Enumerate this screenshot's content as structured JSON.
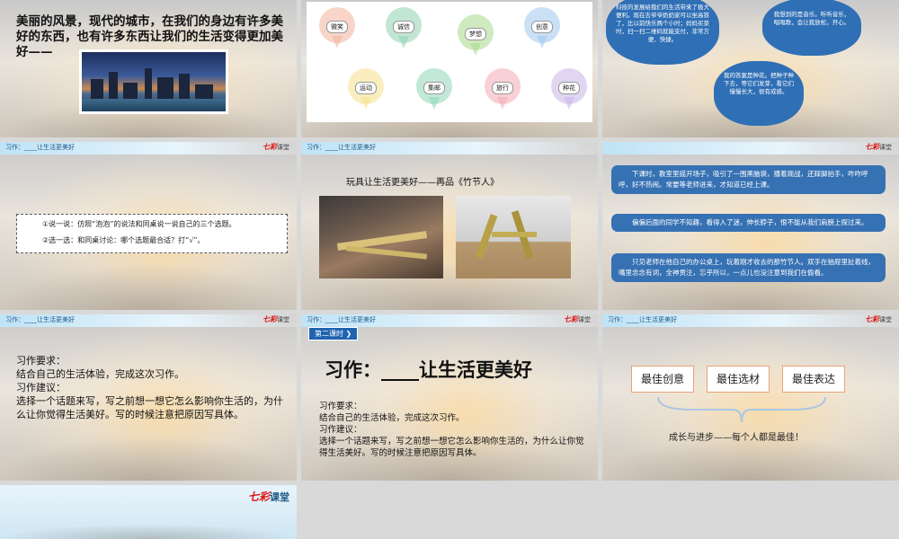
{
  "slides": {
    "s1": {
      "intro": "美丽的风景，现代的城市，在我们的身边有许多美好的东西，也有许多东西让我们的生活变得更加美好——"
    },
    "s2": {
      "bubbles": [
        "微笑",
        "诚信",
        "梦想",
        "创意",
        "运动",
        "集邮",
        "旅行",
        "种花"
      ]
    },
    "s3": {
      "cloud1": "科技的发展给我们的生活带来了极大便利。现在去爷爷奶奶家可以坐高铁了，比以前快乐两个小时；妈妈买菜时，扫一扫二维码就能支付，非常方便、快捷。",
      "cloud2": "我想到的是音乐。听听音乐，唱唱歌，会让我放松，开心。",
      "cloud3": "我的答案是种花。把种子种下去，等它们发芽，看它们慢慢长大，很有成感。"
    },
    "header": {
      "label": "习作：____让生活更美好",
      "logo": "七彩",
      "logo_sub": "课堂"
    },
    "s4": {
      "line1": "①说一说：仿照“泡泡”的说法和同桌说一说自己的三个选题。",
      "line2": "②选一选：和同桌讨论：哪个选题最合适？打“√”。"
    },
    "s5": {
      "title": "玩具让生活更美好——再品《竹节人》"
    },
    "s6": {
      "para1": "下课时，教室里摇开场子，吸引了一围黑脑袋，播着观战，还踩脚拍手，咋咋呼呼，好不热闹。常要等老师进来，才知道已经上课。",
      "para2": "偏偏后面的同学不知趣，看得入了迷，伸长脖子，恨不能从我们肩膀上探过来。",
      "para3": "只见老师在他自己的办公桌上，玩着刚才收去的那竹节人。双手在抽屉里扯着线，嘴里念念有词，全神贯注，忘乎所以，一点儿也没注意到我们在偷看。"
    },
    "s7": {
      "req_title": "习作要求：",
      "req": "结合自己的生活体验，完成这次习作。",
      "sug_title": "习作建议：",
      "sug": "选择一个话题来写，写之前想一想它怎么影响你生活的，为什么让你觉得生活美好。写的时候注意把原因写具体。"
    },
    "s8": {
      "badge": "第二课时",
      "title": "习作：____让生活更美好",
      "req_title": "习作要求：",
      "req": "结合自己的生活体验，完成这次习作。",
      "sug_title": "习作建议：",
      "sug": "选择一个话题来写，写之前想一想它怎么影响你生活的，为什么让你觉得生活美好。写的时候注意把原因写具体。"
    },
    "s9": {
      "awards": [
        "最佳创意",
        "最佳选材",
        "最佳表达"
      ],
      "caption": "成长与进步——每个人都是最佳！"
    },
    "s10": {
      "logo": "七彩",
      "logo_sub": "课堂"
    }
  },
  "colors": {
    "accent_blue": "#2f6fb5",
    "logo_red": "#d11111",
    "award_border": "#e8a37a"
  }
}
